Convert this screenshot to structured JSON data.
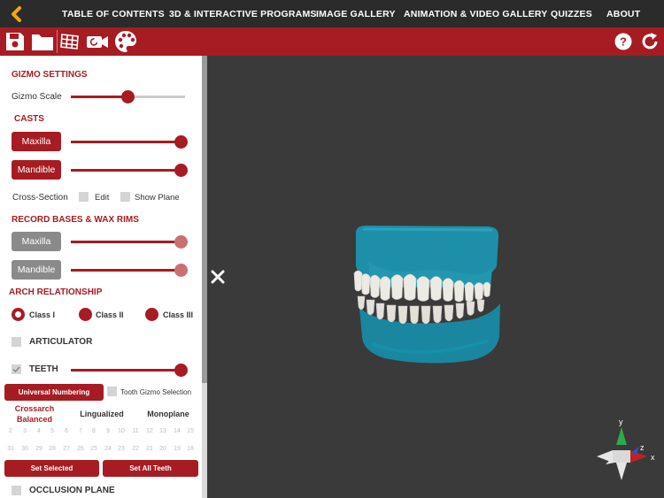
{
  "nav": {
    "links": [
      "TABLE OF CONTENTS",
      "3D & INTERACTIVE PROGRAMS",
      "IMAGE GALLERY",
      "ANIMATION & VIDEO GALLERY",
      "QUIZZES",
      "ABOUT"
    ]
  },
  "toolbar": {
    "icons": [
      "save-icon",
      "folder-icon",
      "grid-icon",
      "camera-icon",
      "palette-icon",
      "help-icon",
      "reset-icon"
    ]
  },
  "gizmo": {
    "title": "GIZMO SETTINGS",
    "scale_label": "Gizmo Scale",
    "scale_value": 0.5
  },
  "casts": {
    "title": "CASTS",
    "maxilla": "Maxilla",
    "mandible": "Mandible",
    "maxilla_value": 1.0,
    "mandible_value": 1.0,
    "cross_section": "Cross-Section",
    "edit": "Edit",
    "show_plane": "Show Plane"
  },
  "bases": {
    "title": "RECORD BASES & WAX RIMS",
    "maxilla": "Maxilla",
    "mandible": "Mandible",
    "maxilla_value": 1.0,
    "mandible_value": 1.0
  },
  "arch": {
    "title": "ARCH RELATIONSHIP",
    "options": [
      "Class I",
      "Class II",
      "Class III"
    ],
    "selected": "Class I"
  },
  "articulator": {
    "label": "ARTICULATOR",
    "checked": false
  },
  "teeth": {
    "label": "TEETH",
    "checked": true,
    "value": 1.0
  },
  "numbering": {
    "button": "Universal Numbering",
    "gizmo_selection": "Tooth Gizmo Selection"
  },
  "occlusion_types": [
    "Crossarch Balanced",
    "Lingualized",
    "Monoplane"
  ],
  "upper_numbers": [
    "2",
    "3",
    "4",
    "5",
    "6",
    "7",
    "8",
    "9",
    "10",
    "11",
    "12",
    "13",
    "14",
    "15"
  ],
  "lower_numbers": [
    "31",
    "30",
    "29",
    "28",
    "27",
    "26",
    "25",
    "24",
    "23",
    "22",
    "21",
    "20",
    "19",
    "18"
  ],
  "actions": {
    "set_selected": "Set Selected",
    "set_all": "Set All Teeth"
  },
  "occlusion_plane": {
    "label": "OCCLUSION PLANE",
    "checked": false
  },
  "viewport": {
    "background": "#3a3a3a",
    "cast_color": "#1e8fa8",
    "axis_y": "y",
    "axis_z": "z",
    "axis_x": "x"
  },
  "colors": {
    "accent": "#a61c22",
    "nav_bg": "#2b2b2b",
    "back_arrow": "#f2a900"
  }
}
